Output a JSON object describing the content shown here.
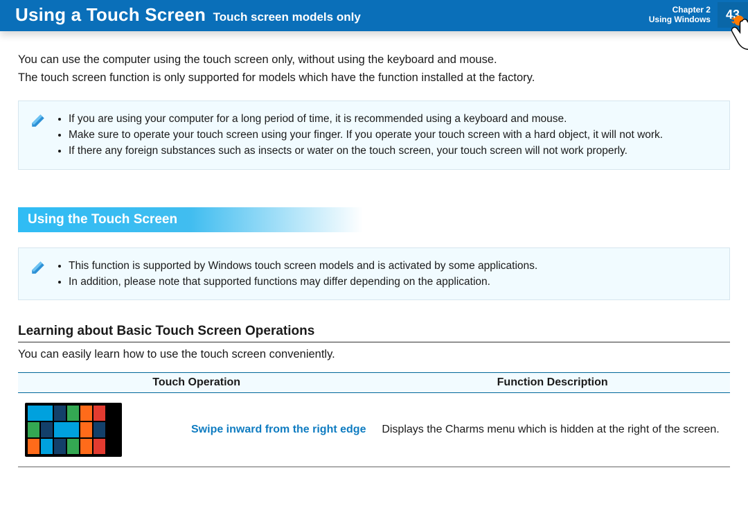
{
  "header": {
    "title": "Using a Touch Screen",
    "subtitle": "Touch screen models only",
    "chapter_line": "Chapter 2",
    "section_line": "Using Windows",
    "page": "43"
  },
  "intro": {
    "p1": "You can use the computer using the touch screen only, without using the keyboard and mouse.",
    "p2": "The touch screen function is only supported for models which have the function installed at the factory."
  },
  "note1": {
    "items": [
      "If you are using your computer for a long period of time, it is recommended using a keyboard and mouse.",
      "Make sure to operate your touch screen using your finger. If you operate your touch screen with a hard object, it will not work.",
      "If there any foreign substances such as insects or water on the touch screen, your touch screen will not work properly."
    ]
  },
  "section_heading": "Using the Touch Screen",
  "note2": {
    "items": [
      "This function is supported by Windows touch screen models and is activated by some applications.",
      "In addition, please note that supported functions may differ depending on the application."
    ]
  },
  "ops": {
    "heading": "Learning about Basic Touch Screen Operations",
    "sub": "You can easily learn how to use the touch screen conveniently.",
    "th1": "Touch Operation",
    "th2": "Function Description",
    "rows": [
      {
        "name": "Swipe inward from the right edge",
        "desc": "Displays the Charms menu which is hidden at the right of the screen."
      }
    ]
  }
}
